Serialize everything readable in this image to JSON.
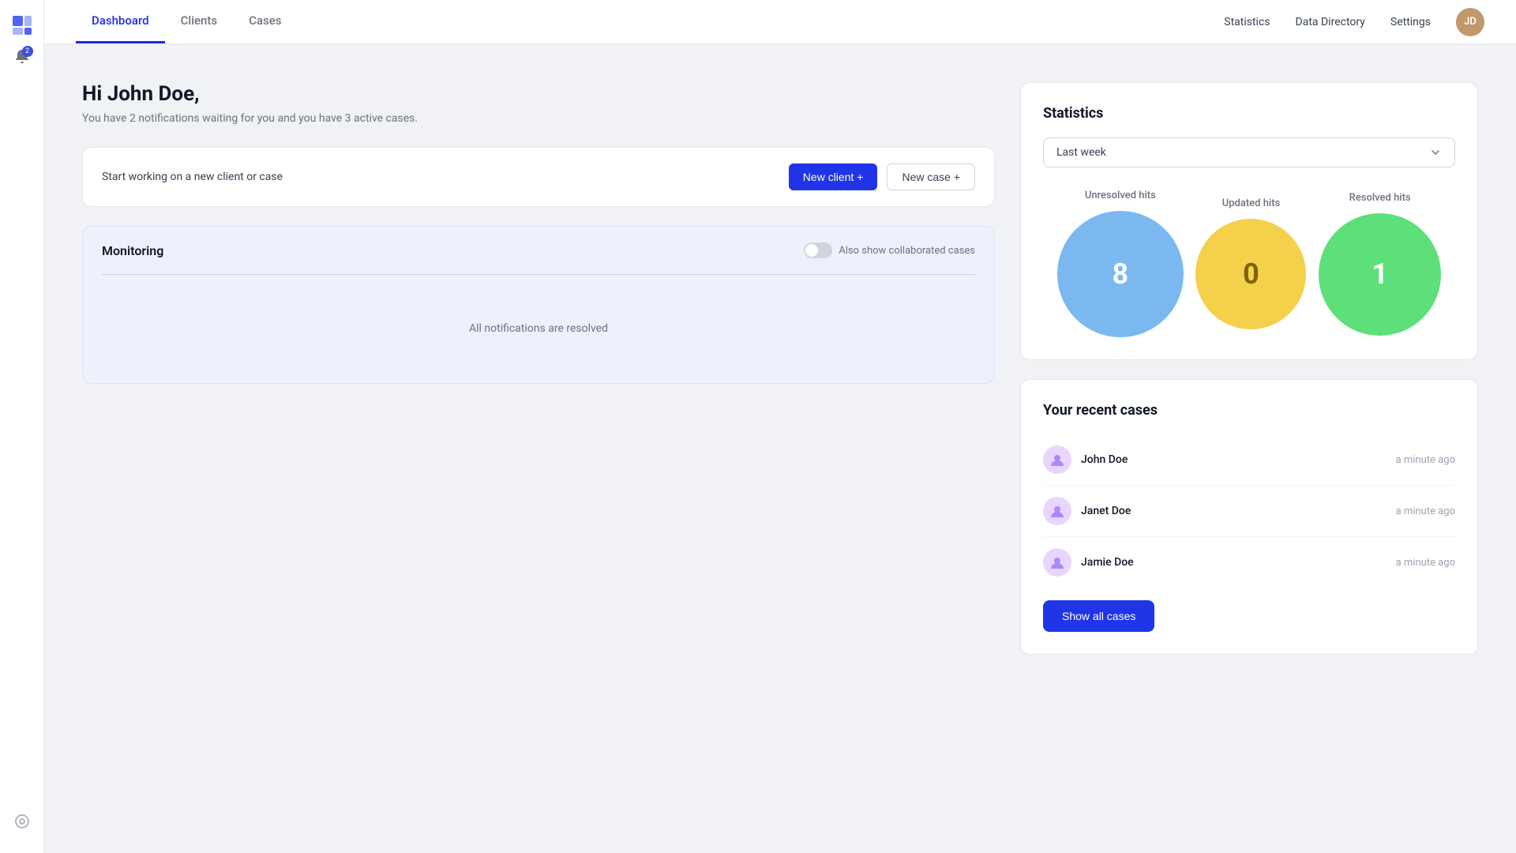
{
  "sidebar": {
    "logo_text": "logo",
    "notification_count": "2",
    "settings_icon": "settings-icon"
  },
  "nav": {
    "tabs": [
      {
        "label": "Dashboard",
        "active": true
      },
      {
        "label": "Clients",
        "active": false
      },
      {
        "label": "Cases",
        "active": false
      }
    ],
    "right_links": [
      {
        "label": "Statistics"
      },
      {
        "label": "Data Directory"
      },
      {
        "label": "Settings"
      }
    ],
    "user_initials": "JD"
  },
  "greeting": {
    "title": "Hi John Doe,",
    "subtitle": "You have 2 notifications waiting for you and you have 3 active cases."
  },
  "action_card": {
    "text": "Start working on a new client or case",
    "btn_new_client": "New client +",
    "btn_new_case": "New case +"
  },
  "monitoring": {
    "title": "Monitoring",
    "toggle_label": "Also show collaborated cases",
    "empty_text": "All notifications are resolved"
  },
  "statistics": {
    "title": "Statistics",
    "filter_label": "Last week",
    "items": [
      {
        "label": "Unresolved hits",
        "value": "8",
        "color": "#7bb8f0",
        "size": 160
      },
      {
        "label": "Updated hits",
        "value": "0",
        "color": "#f5d04a",
        "size": 140
      },
      {
        "label": "Resolved hits",
        "value": "1",
        "color": "#5ddf7a",
        "size": 155
      }
    ]
  },
  "recent_cases": {
    "title": "Your recent cases",
    "cases": [
      {
        "name": "John Doe",
        "time": "a minute ago"
      },
      {
        "name": "Janet Doe",
        "time": "a minute ago"
      },
      {
        "name": "Jamie Doe",
        "time": "a minute ago"
      }
    ],
    "show_all_btn": "Show all cases"
  }
}
